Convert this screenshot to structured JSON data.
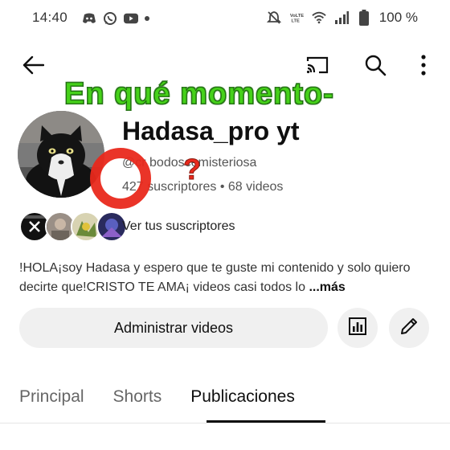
{
  "status_bar": {
    "time": "14:40",
    "battery": "100 %",
    "left_icons": [
      "discord-icon",
      "whatsapp-icon",
      "youtube-icon",
      "dot-icon"
    ],
    "right_icons": [
      "mute-icon",
      "volte-icon",
      "wifi-icon",
      "signal-icon",
      "battery-icon"
    ]
  },
  "app_bar": {
    "back_icon": "arrow-left-icon",
    "cast_icon": "cast-icon",
    "search_icon": "search-icon",
    "more_icon": "more-vertical-icon"
  },
  "overlay": {
    "caption": "En qué momento-",
    "caption_color": "#46d11a",
    "question_mark": "?",
    "annotation_color": "#e9291c"
  },
  "channel": {
    "name": "Hadasa_pro yt",
    "handle": "@cr bodoscemisteriosa",
    "subscribers": "427 suscriptores",
    "separator": "•",
    "videos": "68 videos",
    "subscribers_link": "Ver tus suscriptores",
    "description": "!HOLA¡soy Hadasa y espero que te guste mi contenido y solo quiero decirte que!CRISTO TE AMA¡ videos casi todos lo",
    "more": "...más"
  },
  "actions": {
    "manage_videos": "Administrar videos",
    "analytics_icon": "analytics-icon",
    "edit_icon": "pencil-icon"
  },
  "tabs": [
    {
      "label": "Principal"
    },
    {
      "label": "Shorts"
    },
    {
      "label": "Publicaciones",
      "active": true
    }
  ]
}
